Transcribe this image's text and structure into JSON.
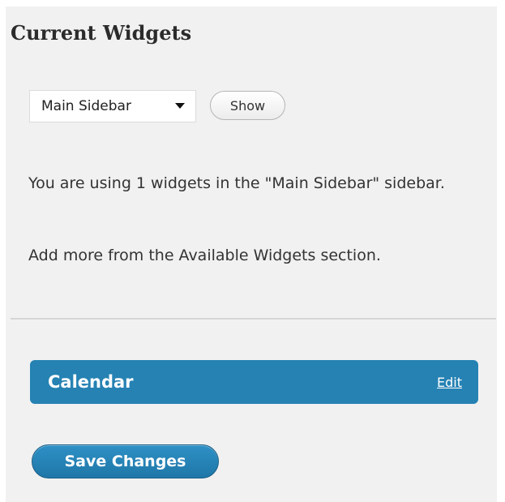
{
  "panel": {
    "title": "Current Widgets"
  },
  "sidebar_select": {
    "selected": "Main Sidebar",
    "show_label": "Show"
  },
  "info": {
    "usage_text": "You are using 1 widgets in the \"Main Sidebar\" sidebar.",
    "hint_text": "Add more from the Available Widgets section."
  },
  "widgets": [
    {
      "title": "Calendar",
      "edit_label": "Edit"
    }
  ],
  "actions": {
    "save_label": "Save Changes"
  },
  "colors": {
    "panel_bg": "#f1f1f1",
    "widget_bg": "#2582b3",
    "save_button_bg": "#1f77a8"
  }
}
